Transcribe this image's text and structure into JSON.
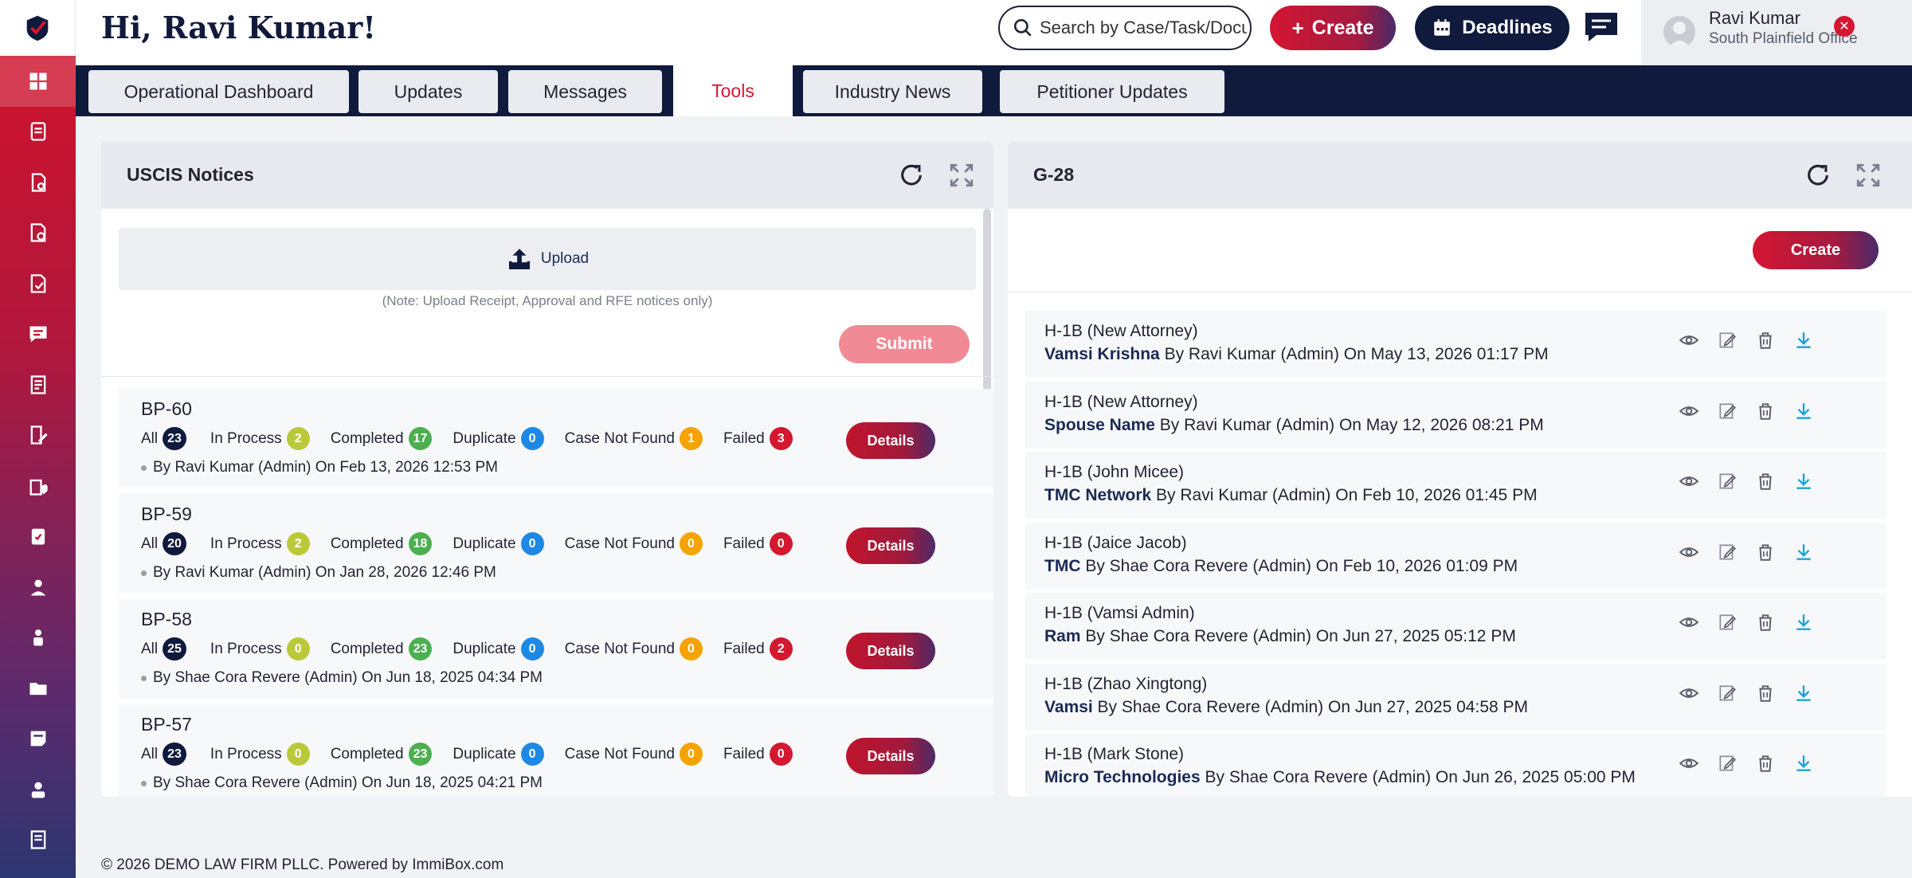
{
  "header": {
    "greeting": "Hi, Ravi Kumar!",
    "search_placeholder": "Search by Case/Task/Docu",
    "create_label": "Create",
    "deadlines_label": "Deadlines",
    "user_name": "Ravi Kumar",
    "user_office": "South Plainfield Office"
  },
  "tabs": [
    {
      "label": "Operational Dashboard"
    },
    {
      "label": "Updates"
    },
    {
      "label": "Messages"
    },
    {
      "label": "Tools"
    },
    {
      "label": "Industry News"
    },
    {
      "label": "Petitioner Updates"
    }
  ],
  "active_tab": "Tools",
  "uscis": {
    "title": "USCIS Notices",
    "upload_label": "Upload",
    "note": "(Note: Upload Receipt, Approval and RFE notices only)",
    "submit_label": "Submit",
    "stat_labels": {
      "all": "All",
      "in_process": "In Process",
      "completed": "Completed",
      "duplicate": "Duplicate",
      "case_not_found": "Case Not Found",
      "failed": "Failed"
    },
    "details_label": "Details",
    "items": [
      {
        "title": "BP-60",
        "all": "23",
        "in_process": "2",
        "completed": "17",
        "duplicate": "0",
        "case_not_found": "1",
        "failed": "3",
        "by": "By Ravi Kumar (Admin) On Feb 13, 2026 12:53 PM"
      },
      {
        "title": "BP-59",
        "all": "20",
        "in_process": "2",
        "completed": "18",
        "duplicate": "0",
        "case_not_found": "0",
        "failed": "0",
        "by": "By Ravi Kumar (Admin) On Jan 28, 2026 12:46 PM"
      },
      {
        "title": "BP-58",
        "all": "25",
        "in_process": "0",
        "completed": "23",
        "duplicate": "0",
        "case_not_found": "0",
        "failed": "2",
        "by": "By Shae Cora Revere (Admin) On Jun 18, 2025 04:34 PM"
      },
      {
        "title": "BP-57",
        "all": "23",
        "in_process": "0",
        "completed": "23",
        "duplicate": "0",
        "case_not_found": "0",
        "failed": "0",
        "by": "By Shae Cora Revere (Admin) On Jun 18, 2025 04:21 PM"
      }
    ]
  },
  "g28": {
    "title": "G-28",
    "create_label": "Create",
    "items": [
      {
        "title": "H-1B (New Attorney)",
        "name": "Vamsi Krishna",
        "by": " By Ravi Kumar (Admin) On May 13, 2026 01:17 PM"
      },
      {
        "title": "H-1B (New Attorney)",
        "name": "Spouse Name",
        "by": " By Ravi Kumar (Admin) On May 12, 2026 08:21 PM"
      },
      {
        "title": "H-1B (John Micee)",
        "name": "TMC Network",
        "by": " By Ravi Kumar (Admin) On Feb 10, 2026 01:45 PM"
      },
      {
        "title": "H-1B (Jaice Jacob)",
        "name": "TMC",
        "by": " By Shae Cora Revere (Admin) On Feb 10, 2026 01:09 PM"
      },
      {
        "title": "H-1B (Vamsi Admin)",
        "name": "Ram",
        "by": " By Shae Cora Revere (Admin) On Jun 27, 2025 05:12 PM"
      },
      {
        "title": "H-1B (Zhao Xingtong)",
        "name": "Vamsi",
        "by": " By Shae Cora Revere (Admin) On Jun 27, 2025 04:58 PM"
      },
      {
        "title": "H-1B (Mark Stone)",
        "name": "Micro Technologies",
        "by": " By Shae Cora Revere (Admin) On Jun 26, 2025 05:00 PM"
      }
    ]
  },
  "footer": "© 2026 DEMO LAW FIRM PLLC. Powered by ImmiBox.com",
  "colors": {
    "brand_red": "#d41632",
    "navy": "#0f1a3d",
    "download_blue": "#1aa3d9"
  }
}
